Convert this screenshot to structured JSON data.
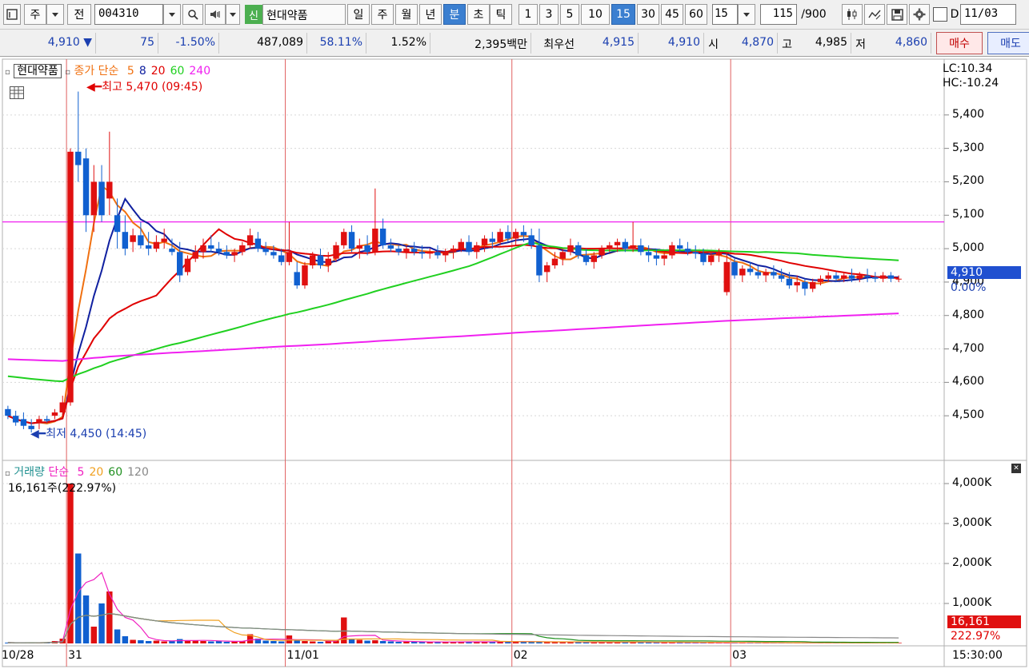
{
  "toolbar": {
    "market": "주",
    "period_mode": "전",
    "code": "004310",
    "badge": "신",
    "stock_name": "현대약품",
    "periods": [
      "일",
      "주",
      "월",
      "년",
      "분",
      "초",
      "틱"
    ],
    "selected_period": "분",
    "intervals": [
      "1",
      "3",
      "5",
      "10",
      "15",
      "30",
      "45",
      "60"
    ],
    "selected_interval": "15",
    "interval_value": "15",
    "count_value": "115",
    "count_max": "/900",
    "date_label": "D",
    "date_value": "11/03"
  },
  "pricebar": {
    "price": "4,910",
    "change": "75",
    "change_pct": "-1.50%",
    "volume": "487,089",
    "volume_ratio": "58.11%",
    "turnover": "1.52%",
    "amount": "2,395백만",
    "best_label": "최우선",
    "best_ask": "4,915",
    "best_bid": "4,910",
    "open_label": "시",
    "open": "4,870",
    "high_label": "고",
    "high": "4,985",
    "low_label": "저",
    "low": "4,860",
    "buy_label": "매수",
    "sell_label": "매도"
  },
  "price_panel": {
    "name": "현대약품",
    "legend_prefix": "종가 단순",
    "ma_labels": [
      "5",
      "8",
      "20",
      "60",
      "240"
    ],
    "ma_colors": [
      "#f07010",
      "#1020a0",
      "#e00000",
      "#20d020",
      "#f020f0"
    ],
    "high_note": "최고 5,470 (09:45)",
    "low_note": "최저 4,450 (14:45)",
    "lc": "LC:10.34",
    "hc": "HC:-10.24",
    "current_price_tag": "4,910",
    "current_pct_tag": "0.00%",
    "y_ticks": [
      "5,400",
      "5,300",
      "5,200",
      "5,100",
      "5,000",
      "4,900",
      "4,800",
      "4,700",
      "4,600",
      "4,500"
    ]
  },
  "volume_panel": {
    "title": "거래량",
    "legend_prefix": "단순",
    "ma_labels": [
      "5",
      "20",
      "60",
      "120"
    ],
    "ma_colors": [
      "#f020c0",
      "#f0a020",
      "#209020",
      "#888888"
    ],
    "current_volume": "16,161주(222.97%)",
    "volume_tag": "16,161",
    "ratio_tag": "222.97%",
    "y_ticks": [
      "4,000K",
      "3,000K",
      "2,000K",
      "1,000K"
    ]
  },
  "x_axis": {
    "labels": [
      "10/28",
      "31",
      "11/01",
      "02",
      "03"
    ],
    "time_label": "15:30:00"
  },
  "chart_data": {
    "type": "candlestick",
    "price_axis": {
      "ylim": [
        4400,
        5500
      ],
      "ticks": [
        4500,
        4600,
        4700,
        4800,
        4900,
        5000,
        5100,
        5200,
        5300,
        5400
      ]
    },
    "volume_axis": {
      "ylim": [
        0,
        4300000
      ],
      "ticks": [
        1000000,
        2000000,
        3000000,
        4000000
      ]
    },
    "horizontal_line": 5080,
    "candles": [
      [
        4520,
        4530,
        4490,
        4500
      ],
      [
        4500,
        4515,
        4470,
        4480
      ],
      [
        4490,
        4510,
        4460,
        4470
      ],
      [
        4470,
        4490,
        4450,
        4460
      ],
      [
        4480,
        4500,
        4460,
        4490
      ],
      [
        4490,
        4500,
        4480,
        4485
      ],
      [
        4500,
        4520,
        4490,
        4510
      ],
      [
        4510,
        4560,
        4500,
        4540
      ],
      [
        4540,
        5300,
        4530,
        5290
      ],
      [
        5290,
        5470,
        5200,
        5250
      ],
      [
        5270,
        5300,
        5050,
        5100
      ],
      [
        5100,
        5250,
        5050,
        5200
      ],
      [
        5200,
        5250,
        5080,
        5100
      ],
      [
        5150,
        5350,
        5100,
        5200
      ],
      [
        5100,
        5150,
        5000,
        5050
      ],
      [
        5050,
        5100,
        4980,
        5000
      ],
      [
        5020,
        5060,
        4990,
        5040
      ],
      [
        5040,
        5080,
        5000,
        5010
      ],
      [
        5010,
        5050,
        4980,
        5000
      ],
      [
        5000,
        5040,
        4990,
        5020
      ],
      [
        5020,
        5060,
        5000,
        5030
      ],
      [
        5000,
        5030,
        4980,
        4990
      ],
      [
        4990,
        5020,
        4900,
        4920
      ],
      [
        4930,
        4980,
        4920,
        4970
      ],
      [
        4970,
        5010,
        4960,
        4990
      ],
      [
        4990,
        5030,
        4970,
        5010
      ],
      [
        5010,
        5040,
        4990,
        5000
      ],
      [
        5000,
        5020,
        4980,
        4990
      ],
      [
        4990,
        5010,
        4970,
        4980
      ],
      [
        4980,
        5000,
        4960,
        4990
      ],
      [
        4990,
        5020,
        4980,
        5010
      ],
      [
        5010,
        5060,
        5000,
        5040
      ],
      [
        5030,
        5050,
        4990,
        5000
      ],
      [
        5000,
        5020,
        4980,
        4990
      ],
      [
        4990,
        5010,
        4970,
        4980
      ],
      [
        4980,
        5000,
        4950,
        4960
      ],
      [
        4960,
        5080,
        4950,
        4990
      ],
      [
        4930,
        4960,
        4880,
        4890
      ],
      [
        4890,
        4960,
        4880,
        4950
      ],
      [
        4950,
        4990,
        4940,
        4980
      ],
      [
        4980,
        5000,
        4940,
        4950
      ],
      [
        4950,
        4990,
        4930,
        4970
      ],
      [
        4970,
        5020,
        4960,
        5010
      ],
      [
        5010,
        5060,
        5000,
        5050
      ],
      [
        5050,
        5070,
        4990,
        5000
      ],
      [
        5000,
        5030,
        4970,
        5010
      ],
      [
        5010,
        5040,
        4980,
        4990
      ],
      [
        4990,
        5180,
        4980,
        5060
      ],
      [
        5060,
        5090,
        5000,
        5010
      ],
      [
        5010,
        5030,
        4990,
        5000
      ],
      [
        5000,
        5010,
        4980,
        4990
      ],
      [
        4990,
        5010,
        4970,
        5000
      ],
      [
        5000,
        5020,
        4980,
        4990
      ],
      [
        4990,
        5010,
        4970,
        4985
      ],
      [
        4985,
        5000,
        4970,
        4990
      ],
      [
        4990,
        5010,
        4970,
        4980
      ],
      [
        4980,
        5000,
        4960,
        4990
      ],
      [
        4990,
        5010,
        4970,
        5000
      ],
      [
        5000,
        5030,
        4990,
        5020
      ],
      [
        5020,
        5040,
        4980,
        4990
      ],
      [
        4990,
        5020,
        4970,
        5010
      ],
      [
        5010,
        5040,
        4990,
        5030
      ],
      [
        5030,
        5050,
        5000,
        5020
      ],
      [
        5020,
        5060,
        5010,
        5050
      ],
      [
        5050,
        5070,
        5020,
        5030
      ],
      [
        5030,
        5060,
        5010,
        5050
      ],
      [
        5050,
        5070,
        5020,
        5040
      ],
      [
        5040,
        5060,
        5000,
        5010
      ],
      [
        5010,
        5060,
        4900,
        4920
      ],
      [
        4930,
        4960,
        4900,
        4950
      ],
      [
        4950,
        4990,
        4940,
        4970
      ],
      [
        4970,
        5000,
        4950,
        4990
      ],
      [
        4990,
        5030,
        4980,
        5010
      ],
      [
        5010,
        5020,
        4970,
        4980
      ],
      [
        4980,
        5000,
        4950,
        4960
      ],
      [
        4960,
        4990,
        4940,
        4980
      ],
      [
        4980,
        5010,
        4970,
        5000
      ],
      [
        5000,
        5020,
        4990,
        5010
      ],
      [
        5010,
        5030,
        4990,
        5020
      ],
      [
        5020,
        5030,
        4990,
        5000
      ],
      [
        5000,
        5080,
        4990,
        5010
      ],
      [
        5010,
        5030,
        4980,
        4990
      ],
      [
        4990,
        5010,
        4960,
        4980
      ],
      [
        4980,
        5000,
        4950,
        4970
      ],
      [
        4970,
        4990,
        4950,
        4980
      ],
      [
        4980,
        5020,
        4970,
        5010
      ],
      [
        5010,
        5030,
        4990,
        5000
      ],
      [
        5000,
        5020,
        4980,
        4990
      ],
      [
        4990,
        5010,
        4970,
        4985
      ],
      [
        4985,
        5000,
        4950,
        4960
      ],
      [
        4960,
        4990,
        4950,
        4980
      ],
      [
        4980,
        5000,
        4960,
        4990
      ],
      [
        4870,
        4990,
        4860,
        4960
      ],
      [
        4960,
        4970,
        4910,
        4920
      ],
      [
        4920,
        4950,
        4900,
        4940
      ],
      [
        4940,
        4960,
        4920,
        4930
      ],
      [
        4930,
        4950,
        4910,
        4920
      ],
      [
        4920,
        4940,
        4900,
        4930
      ],
      [
        4930,
        4950,
        4910,
        4920
      ],
      [
        4920,
        4940,
        4900,
        4910
      ],
      [
        4910,
        4930,
        4880,
        4890
      ],
      [
        4890,
        4920,
        4870,
        4900
      ],
      [
        4900,
        4910,
        4860,
        4880
      ],
      [
        4880,
        4910,
        4870,
        4900
      ],
      [
        4900,
        4920,
        4890,
        4910
      ],
      [
        4910,
        4930,
        4900,
        4920
      ],
      [
        4920,
        4930,
        4900,
        4910
      ],
      [
        4910,
        4930,
        4900,
        4920
      ],
      [
        4920,
        4940,
        4900,
        4910
      ],
      [
        4910,
        4930,
        4900,
        4920
      ],
      [
        4920,
        4940,
        4900,
        4915
      ],
      [
        4915,
        4930,
        4900,
        4910
      ],
      [
        4910,
        4930,
        4900,
        4920
      ],
      [
        4920,
        4930,
        4900,
        4910
      ],
      [
        4910,
        4920,
        4900,
        4910
      ]
    ],
    "volumes": [
      20000,
      15000,
      18000,
      12000,
      25000,
      30000,
      60000,
      120000,
      4000000,
      2250000,
      1200000,
      420000,
      1000000,
      1300000,
      350000,
      180000,
      90000,
      80000,
      60000,
      70000,
      50000,
      60000,
      110000,
      70000,
      80000,
      60000,
      50000,
      60000,
      40000,
      50000,
      60000,
      230000,
      120000,
      70000,
      60000,
      50000,
      200000,
      90000,
      60000,
      50000,
      40000,
      60000,
      70000,
      650000,
      120000,
      90000,
      70000,
      80000,
      60000,
      50000,
      40000,
      45000,
      40000,
      35000,
      30000,
      40000,
      35000,
      40000,
      45000,
      40000,
      35000,
      40000,
      45000,
      60000,
      50000,
      40000,
      45000,
      40000,
      35000,
      40000,
      35000,
      30000,
      40000,
      35000,
      30000,
      25000,
      30000,
      35000,
      40000,
      30000,
      35000,
      25000,
      30000,
      20000,
      25000,
      20000,
      25000,
      20000,
      15000,
      20000,
      15000,
      20000,
      18000,
      16000,
      15000,
      14000,
      13000,
      15000,
      14000,
      13000,
      12000,
      14000,
      13000,
      12000,
      15000,
      14000,
      13000,
      12000,
      14000,
      16000,
      15000,
      14000,
      16161,
      15000,
      14000
    ]
  }
}
